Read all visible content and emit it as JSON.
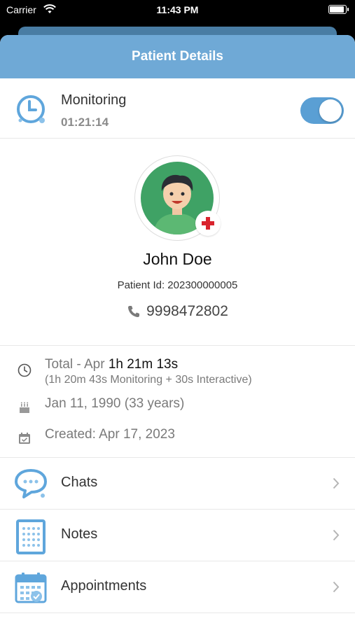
{
  "status_bar": {
    "carrier": "Carrier",
    "time": "11:43 PM"
  },
  "header": {
    "title": "Patient Details"
  },
  "monitoring": {
    "label": "Monitoring",
    "elapsed": "01:21:14",
    "enabled": true
  },
  "patient": {
    "name": "John Doe",
    "id_text": "Patient Id: 202300000005",
    "phone": "9998472802"
  },
  "info": {
    "total_prefix": "Total - Apr ",
    "total_value": "1h 21m 13s",
    "total_breakdown": "(1h 20m 43s Monitoring + 30s Interactive)",
    "dob": "Jan 11, 1990 (33 years)",
    "created": "Created: Apr 17, 2023"
  },
  "menu": [
    {
      "label": "Chats",
      "icon": "chat-bubble-icon"
    },
    {
      "label": "Notes",
      "icon": "notes-icon"
    },
    {
      "label": "Appointments",
      "icon": "calendar-icon"
    }
  ],
  "colors": {
    "accent": "#6fa9d6",
    "toggle": "#5a9fd4",
    "avatar_bg": "#3fa265",
    "badge_cross": "#d9232d"
  }
}
